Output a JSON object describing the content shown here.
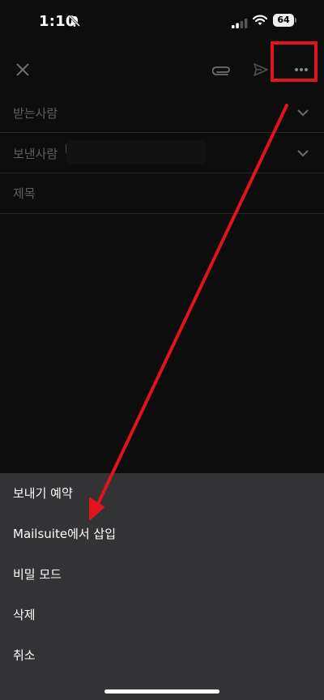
{
  "status": {
    "time": "1:10",
    "battery": "64"
  },
  "toolbar": {
    "close_icon": "close-icon",
    "attach_icon": "paperclip-icon",
    "send_icon": "send-icon",
    "more_icon": "more-horizontal-icon"
  },
  "compose": {
    "to_label": "받는사람",
    "from_label": "보낸사람",
    "from_value_visible": "k",
    "subject_placeholder": "제목"
  },
  "menu": {
    "items": [
      {
        "label": "보내기 예약"
      },
      {
        "label": "Mailsuite에서 삽입"
      },
      {
        "label": "비밀 모드"
      },
      {
        "label": "삭제"
      },
      {
        "label": "취소"
      }
    ]
  },
  "colors": {
    "annotation": "#e0141b",
    "sheet_bg": "#333336",
    "background": "#0d0d0d"
  }
}
